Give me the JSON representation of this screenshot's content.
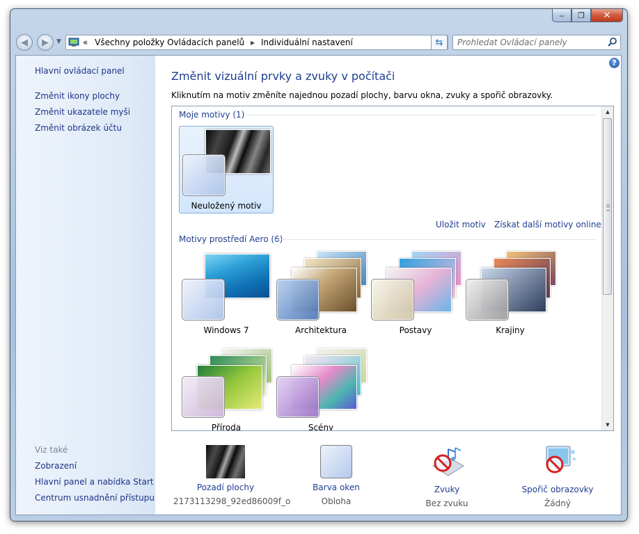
{
  "window": {
    "controls": {
      "minimize": "‒",
      "maximize": "❐",
      "close": "✕"
    }
  },
  "navigation": {
    "back_icon": "back-arrow-icon",
    "forward_icon": "forward-arrow-icon",
    "address": {
      "prefix": "«",
      "crumbs": [
        "Všechny položky Ovládacích panelů",
        "Individuální nastavení"
      ],
      "separator": "▶"
    },
    "refresh_icon": "refresh-icon",
    "search_placeholder": "Prohledat Ovládací panely"
  },
  "sidebar": {
    "home_link": "Hlavní ovládací panel",
    "links": [
      "Změnit ikony plochy",
      "Změnit ukazatele myši",
      "Změnit obrázek účtu"
    ],
    "see_also_heading": "Viz také",
    "see_also": [
      "Zobrazení",
      "Hlavní panel a nabídka Start",
      "Centrum usnadnění přístupu"
    ]
  },
  "main": {
    "title": "Změnit vizuální prvky a zvuky v počítači",
    "description": "Kliknutím na motiv změníte najednou pozadí plochy, barvu okna, zvuky a spořič obrazovky.",
    "help_label": "?"
  },
  "themes": {
    "my_group_label": "Moje motivy (1)",
    "my_themes": [
      {
        "name": "Neuložený motiv",
        "selected": true
      }
    ],
    "save_link": "Uložit motiv",
    "more_link": "Získat další motivy online",
    "aero_group_label": "Motivy prostředí Aero (6)",
    "aero_themes": [
      {
        "name": "Windows 7"
      },
      {
        "name": "Architektura"
      },
      {
        "name": "Postavy"
      },
      {
        "name": "Krajiny"
      },
      {
        "name": "Příroda"
      },
      {
        "name": "Scény"
      }
    ]
  },
  "bottom": {
    "background": {
      "label": "Pozadí plochy",
      "value": "2173113298_92ed86009f_o"
    },
    "color": {
      "label": "Barva oken",
      "value": "Obloha"
    },
    "sounds": {
      "label": "Zvuky",
      "value": "Bez zvuku"
    },
    "screensaver": {
      "label": "Spořič obrazovky",
      "value": "Žádný"
    }
  }
}
